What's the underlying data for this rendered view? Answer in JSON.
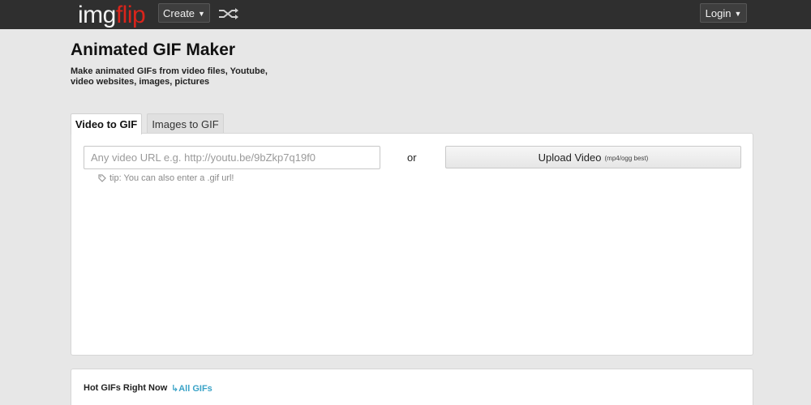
{
  "header": {
    "logo_part1": "img",
    "logo_part2": "flip",
    "create_label": "Create",
    "login_label": "Login",
    "caret": "▼"
  },
  "page": {
    "title": "Animated GIF Maker",
    "subtitle": "Make animated GIFs from video files, Youtube, video websites, images, pictures"
  },
  "tabs": [
    {
      "label": "Video to GIF",
      "active": true
    },
    {
      "label": "Images to GIF",
      "active": false
    }
  ],
  "video_panel": {
    "url_placeholder": "Any video URL e.g. http://youtu.be/9bZkp7q19f0",
    "tip": "tip: You can also enter a .gif url!",
    "or_label": "or",
    "upload_label": "Upload Video",
    "upload_hint": "(mp4/ogg best)"
  },
  "hot_gifs": {
    "title": "Hot GIFs Right Now",
    "all_link": "↳All GIFs"
  },
  "colors": {
    "topbar": "#2f2f2f",
    "logo_accent": "#d9241b",
    "link": "#3aa3c7",
    "background": "#e7e7e7"
  },
  "icons": {
    "shuffle": "shuffle-icon",
    "tip": "tag-icon"
  }
}
